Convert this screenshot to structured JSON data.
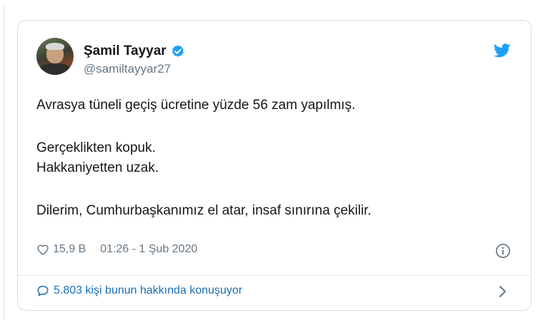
{
  "tweet": {
    "author": {
      "display_name": "Şamil Tayyar",
      "handle": "@samiltayyar27",
      "verified": true
    },
    "text_lines": [
      "Avrasya tüneli geçiş ücretine yüzde 56 zam yapılmış.",
      "Gerçeklikten kopuk.",
      "Hakkaniyetten uzak.",
      "Dilerim, Cumhurbaşkanımız el atar, insaf sınırına çekilir."
    ],
    "likes": "15,9 B",
    "timestamp": "01:26 - 1 Şub 2020",
    "conversation_label": "5.803 kişi bunun hakkında konuşuyor"
  },
  "icons": {
    "brand": "twitter-bird-icon",
    "verified": "verified-badge-icon",
    "like": "heart-icon",
    "info": "info-icon",
    "reply": "speech-bubble-icon",
    "more": "chevron-right-icon"
  },
  "colors": {
    "brand_blue": "#1da1f2",
    "link_blue": "#1b6fb3",
    "text": "#14171a",
    "muted": "#657786",
    "border": "#d9dee3"
  }
}
